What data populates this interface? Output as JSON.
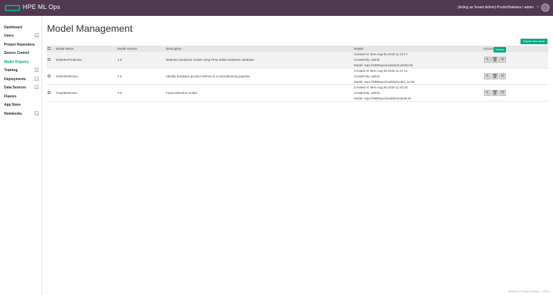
{
  "header": {
    "app_name": "HPE ML Ops",
    "user_info": "(Acting as Tenant Admin) PredictDiabetes / admin",
    "chevron": "⌵"
  },
  "sidebar": {
    "items": [
      {
        "label": "Dashboard",
        "badge": ""
      },
      {
        "label": "Users",
        "badge": "1"
      },
      {
        "label": "Project Repository",
        "badge": ""
      },
      {
        "label": "Source Control",
        "badge": ""
      },
      {
        "label": "Model Registry",
        "badge": "",
        "active": true
      },
      {
        "label": "Training",
        "badge": "2"
      },
      {
        "label": "Deployments",
        "badge": "1"
      },
      {
        "label": "Data Sources",
        "badge": "1"
      },
      {
        "label": "Flavors",
        "badge": ""
      },
      {
        "label": "App Store",
        "badge": ""
      },
      {
        "label": "Notebooks",
        "badge": "1"
      }
    ]
  },
  "main": {
    "title": "Model Management",
    "register_button": "Register New Model",
    "columns": [
      "Model Name",
      "Model Version",
      "Description",
      "Details",
      "Actions"
    ],
    "rows": [
      {
        "name": "DiabetesPrediction",
        "version": "1.0",
        "description": "Diabetes prediction model using Pima Indian Diabetes database",
        "details": [
          "Created At: Mon Aug 05 2019 11:13:17",
          "Created By: admin",
          "Model: repo://DBRepo/models/model33.h5"
        ]
      },
      {
        "name": "DefectDetection",
        "version": "1.0",
        "description": "Identify hardware product defects in a manufacturing pipeline",
        "details": [
          "Created At: Mon Aug 05 2019 11:27:14",
          "Created By: admin",
          "Model: repo://DBRepo/models/model_ac.h5"
        ]
      },
      {
        "name": "FraudDetection",
        "version": "2.0",
        "description": "Fraud detection model",
        "details": [
          "Created At: Mon Aug 05 2019 11:24:43",
          "Created By: admin",
          "Model: repo://DBRepo/models/model5.h5"
        ]
      }
    ],
    "actions": {
      "edit_icon": "✎",
      "delete_icon": "🗑",
      "deploy_icon": "⛛"
    },
    "tooltip": "Deploy"
  },
  "footer": {
    "version": "Version: v.0 Build Number : 11913"
  },
  "colors": {
    "topbar": "#50384f",
    "accent": "#01a982"
  }
}
